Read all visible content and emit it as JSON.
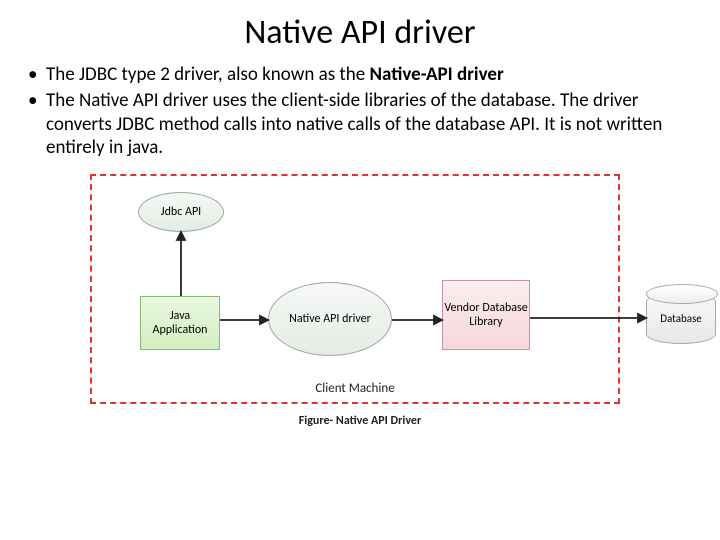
{
  "title": "Native API driver",
  "bullets": [
    {
      "pre": "The JDBC type 2 driver, also known as the ",
      "bold": "Native-API driver",
      "post": ""
    },
    {
      "pre": "The Native API driver uses the client-side libraries of the database. The driver converts JDBC method calls into native calls of the database API. It is not written entirely in java.",
      "bold": "",
      "post": ""
    }
  ],
  "diagram": {
    "client_machine_label": "Client Machine",
    "jdbc_api": "Jdbc API",
    "java_app": "Java Application",
    "native_api_driver": "Native API driver",
    "vendor_lib": "Vendor Database Library",
    "database": "Database"
  },
  "caption": "Figure- Native API Driver"
}
